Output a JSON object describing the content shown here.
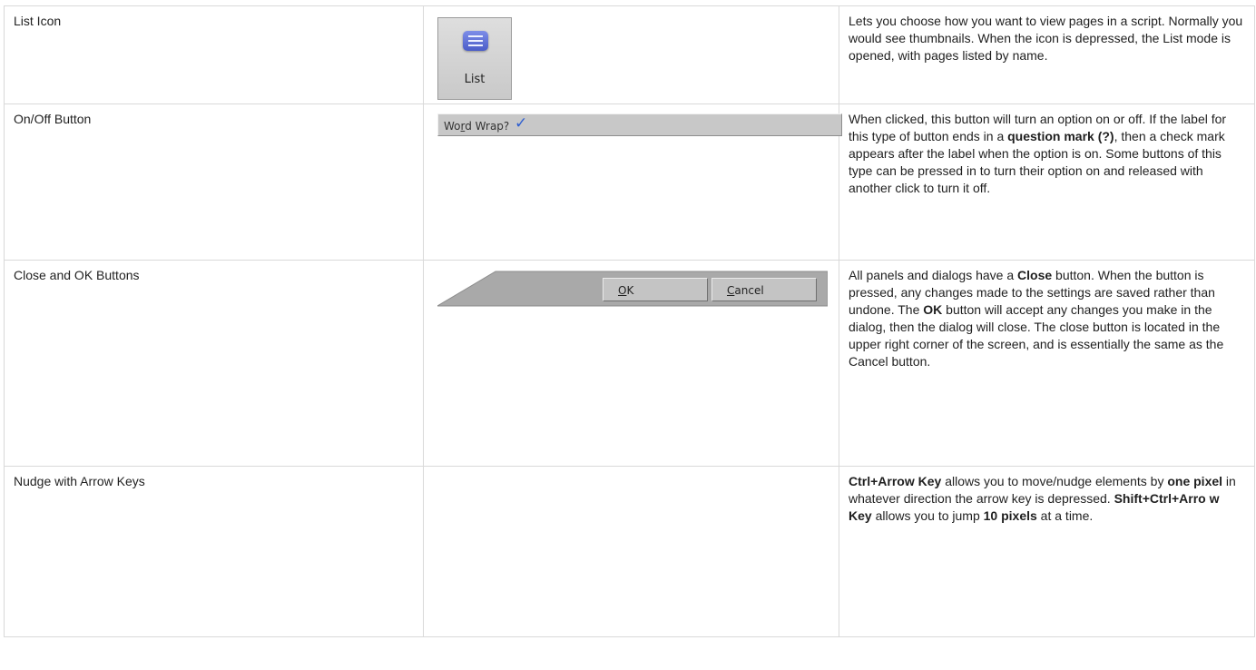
{
  "rows": [
    {
      "name": "List Icon",
      "image": {
        "icon": "list-icon",
        "caption": "List"
      },
      "description": "Lets you choose how you want to view pages in a script. Normally you would see thumbnails. When the icon is depressed, the List mode is opened, with pages listed by name."
    },
    {
      "name": "On/Off Button",
      "image": {
        "label_pre": "Wo",
        "label_underline": "r",
        "label_post": "d Wrap?",
        "icon": "checkmark-icon"
      },
      "description": {
        "p1": "When clicked, this button will turn an option on or off. If the label for this type of button ends in a ",
        "b1": "question mark (?)",
        "p2": ", then a check mark appears after the label when the option is on. Some buttons of this type can be pressed in to turn their option on and released with another click to turn it off."
      }
    },
    {
      "name": "Close and OK Buttons",
      "image": {
        "ok_underline": "O",
        "ok_rest": "K",
        "cancel_underline": "C",
        "cancel_rest": "ancel"
      },
      "description": {
        "p1": "All panels and dialogs have a ",
        "b1": "Close",
        "p2": " button. When the button is pressed, any changes made to the settings are saved rather than undone. The ",
        "b2": "OK",
        "p3": " button will accept any changes you make in the dialog, then the dialog will close. The close button is located in the upper right corner of the screen, and is essentially the same as the Cancel button."
      }
    },
    {
      "name": "Nudge with Arrow Keys",
      "description": {
        "b1": "Ctrl+Arrow Key",
        "p1": " allows you to move/nudge elements by ",
        "b2": "one pixel",
        "p2": " in whatever direction the arrow key is depressed. ",
        "b3": "Shift+Ctrl+Arro w Key",
        "p3": " allows you to jump ",
        "b4": "10 pixels",
        "p4": " at a time."
      }
    }
  ],
  "colors": {
    "border": "#d9d9d9",
    "text": "#1f1f1f",
    "checkmark": "#2f5fd0",
    "list_icon": "#5a6cd8"
  }
}
